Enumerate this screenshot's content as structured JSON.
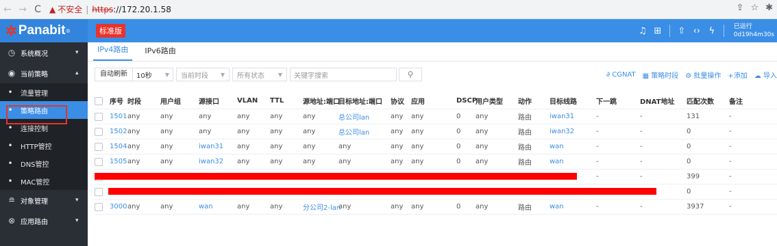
{
  "browser": {
    "warning": "不安全",
    "separator": "|",
    "protocol": "https",
    "host": "://172.20.1.58"
  },
  "header": {
    "logo": "Panabit",
    "logo_mark": "®",
    "edition": "标准版",
    "runtime_label": "已运行",
    "runtime_value": "0d19h4m30s"
  },
  "sidebar": {
    "items": [
      {
        "label": "系统概况",
        "icon": "gauge-icon"
      },
      {
        "label": "当前策略",
        "icon": "location-icon"
      },
      {
        "label": "流量管理"
      },
      {
        "label": "策略路由"
      },
      {
        "label": "连接控制"
      },
      {
        "label": "HTTP管控"
      },
      {
        "label": "DNS管控"
      },
      {
        "label": "MAC管控"
      },
      {
        "label": "对象管理",
        "icon": "database-icon"
      },
      {
        "label": "应用路由",
        "icon": "compass-icon"
      }
    ]
  },
  "tabs": [
    "IPv4路由",
    "IPv6路由"
  ],
  "toolbar": {
    "auto_refresh": "自动刷新",
    "interval": "10秒",
    "time_placeholder": "当前时段",
    "status_placeholder": "所有状态",
    "search_placeholder": "关键字搜索",
    "cgnat": "CGNAT",
    "schedule": "策略时段",
    "batch": "批量操作",
    "add": "添加",
    "import": "导入"
  },
  "table": {
    "columns": [
      "序号",
      "时段",
      "用户组",
      "源接口",
      "VLAN",
      "TTL",
      "源地址:端口",
      "目标地址:端口",
      "协议",
      "应用",
      "DSCP",
      "用户类型",
      "动作",
      "目标线路",
      "下一跳",
      "DNAT地址",
      "匹配次数",
      "备注"
    ],
    "rows": [
      [
        "1501",
        "any",
        "any",
        "any",
        "any",
        "any",
        "any",
        "总公司lan",
        "any",
        "any",
        "0",
        "any",
        "路由",
        "iwan31",
        "-",
        "-",
        "131",
        "-"
      ],
      [
        "1502",
        "any",
        "any",
        "any",
        "any",
        "any",
        "any",
        "总公司lan",
        "any",
        "any",
        "0",
        "any",
        "路由",
        "iwan32",
        "-",
        "-",
        "0",
        "-"
      ],
      [
        "1504",
        "any",
        "any",
        "iwan31",
        "any",
        "any",
        "any",
        "any",
        "any",
        "any",
        "0",
        "any",
        "路由",
        "wan",
        "-",
        "-",
        "0",
        "-"
      ],
      [
        "1505",
        "any",
        "any",
        "iwan32",
        "any",
        "any",
        "any",
        "any",
        "any",
        "any",
        "0",
        "any",
        "路由",
        "wan",
        "-",
        "-",
        "0",
        "-"
      ],
      [
        "",
        "",
        "",
        "",
        "",
        "",
        "",
        "",
        "",
        "",
        "",
        "",
        "",
        "",
        "-",
        "-",
        "399",
        "-"
      ],
      [
        "",
        "",
        "",
        "",
        "",
        "",
        "",
        "",
        "",
        "",
        "",
        "",
        "",
        "",
        "-",
        "-",
        "0",
        "-"
      ],
      [
        "3000",
        "any",
        "any",
        "wan",
        "any",
        "any",
        "分公司2-lan",
        "any",
        "any",
        "any",
        "0",
        "any",
        "路由",
        "wan",
        "-",
        "-",
        "3937",
        "-"
      ]
    ]
  },
  "colors": {
    "primary": "#3a8ee6",
    "sidebar": "#2a2f36",
    "danger": "#e8332a",
    "redaction": "#ff0000"
  }
}
